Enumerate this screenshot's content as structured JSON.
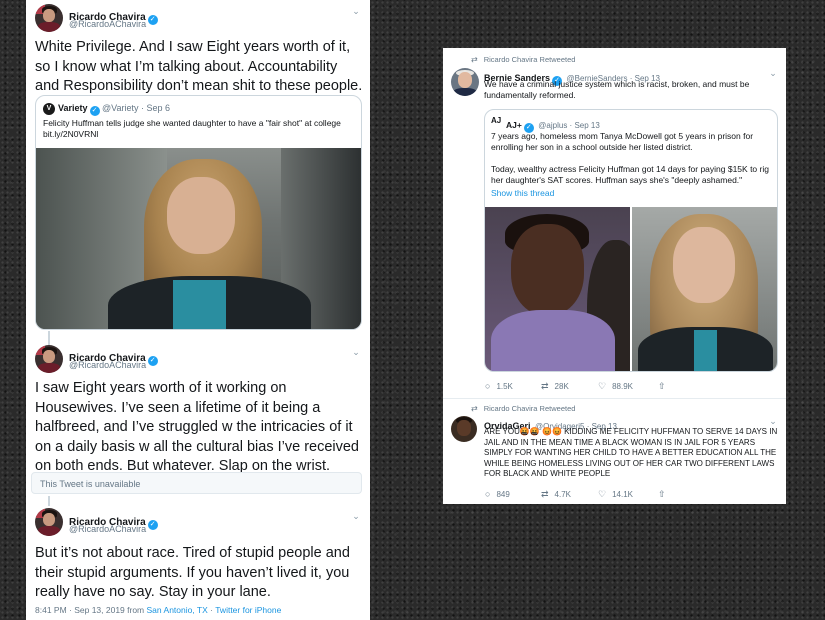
{
  "left": {
    "tweet1": {
      "name": "Ricardo Chavira",
      "handle": "@RicardoAChavira",
      "text": "White Privilege. And I saw Eight years worth of it, so I know what I’m talking about. Accountability and Responsibility don’t mean shit to these people.",
      "quote": {
        "name": "Variety",
        "handle": "@Variety",
        "date": "Sep 6",
        "logo_text": "V",
        "text": "Felicity Huffman tells judge she wanted daughter to have a \"fair shot\" at college",
        "link": "bit.ly/2N0VRNl"
      }
    },
    "tweet2": {
      "name": "Ricardo Chavira",
      "handle": "@RicardoAChavira",
      "text": "I saw Eight years worth of it working on Housewives. I’ve seen a lifetime of it being a halfbreed, and I’ve struggled w the intricacies of it on a daily basis w all the cultural bias I’ve received on both ends. But whatever. Slap on the wrist. Sorry, but this shit",
      "unavailable": "This Tweet is unavailable"
    },
    "tweet3": {
      "name": "Ricardo Chavira",
      "handle": "@RicardoAChavira",
      "text": "But it’s not about race. Tired of stupid people and their stupid arguments. If you haven’t lived it, you really have no say. Stay in your lane.",
      "meta_time": "8:41 PM · Sep 13, 2019 from ",
      "meta_location": "San Antonio, TX",
      "meta_sep": " · ",
      "meta_client": "Twitter for iPhone"
    }
  },
  "right": {
    "retweet1": {
      "label": "Ricardo Chavira Retweeted",
      "name": "Bernie Sanders",
      "handle": "@BernieSanders",
      "date": "Sep 13",
      "text": "We have a criminal justice system which is racist, broken, and must be fundamentally reformed.",
      "quote": {
        "logo_text": "AJ",
        "name": "AJ+",
        "handle": "@ajplus",
        "date": "Sep 13",
        "text1": "7 years ago, homeless mom Tanya McDowell got 5 years in prison for enrolling her son in a school outside her listed district.",
        "text2": "Today, wealthy actress Felicity Huffman got 14 days for paying $15K to rig her daughter's SAT scores. Huffman says she's \"deeply ashamed.\"",
        "show_thread": "Show this thread"
      },
      "actions": {
        "replies": "1.5K",
        "retweets": "28K",
        "likes": "88.9K"
      }
    },
    "retweet2": {
      "label": "Ricardo Chavira Retweeted",
      "name": "OrvidaGeri",
      "handle": "@Orvidageri5",
      "date": "Sep 13",
      "text": "ARE YOU🤬🤬 😡😡 KIDDING ME FELICITY HUFFMAN TO SERVE 14 DAYS IN JAIL AND IN THE MEAN TIME A BLACK WOMAN IS IN JAIL FOR 5 YEARS SIMPLY FOR WANTING HER CHILD TO HAVE A BETTER EDUCATION ALL THE WHILE BEING HOMELESS LIVING OUT OF HER CAR TWO DIFFERENT LAWS FOR BLACK AND WHITE PEOPLE",
      "actions": {
        "replies": "849",
        "retweets": "4.7K",
        "likes": "14.1K"
      }
    }
  },
  "glyphs": {
    "verified": "✓",
    "chevron": "⌄",
    "retweet": "⇄",
    "reply": "○",
    "like": "♡",
    "share": "⇧",
    "bullet": " · "
  },
  "colors": {
    "link": "#1b95e0",
    "verified": "#1da1f2",
    "secondary_text": "#657786"
  }
}
